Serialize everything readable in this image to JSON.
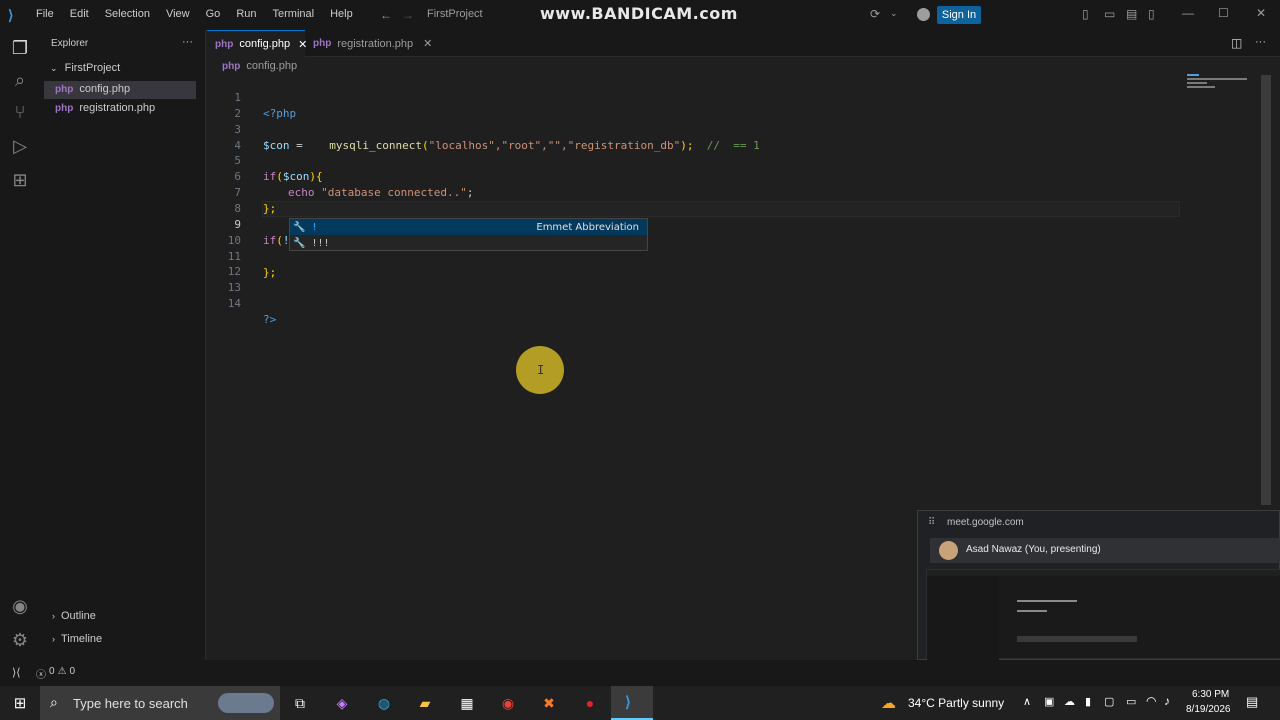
{
  "titlebar": {
    "menus": [
      "File",
      "Edit",
      "Selection",
      "View",
      "Go",
      "Run",
      "Terminal",
      "Help"
    ],
    "search_label": "FirstProject",
    "watermark": "www.BANDICAM.com",
    "signin_label": "Sign In"
  },
  "sidebar": {
    "title": "Explorer",
    "project": "FirstProject",
    "files": [
      "config.php",
      "registration.php"
    ],
    "outline_label": "Outline",
    "timeline_label": "Timeline"
  },
  "tabs": [
    {
      "label": "config.php"
    },
    {
      "label": "registration.php"
    }
  ],
  "breadcrumb": "config.php",
  "code": {
    "line_numbers": [
      "1",
      "2",
      "3",
      "4",
      "5",
      "6",
      "7",
      "8",
      "9",
      "10",
      "11",
      "12",
      "13",
      "14"
    ],
    "l1": "<?php",
    "l3a": "$con",
    "l3b": " = ",
    "l3c": "mysqli_connect",
    "l3d": "(",
    "l3e": "\"localhos\",\"root\",\"\",\"registration_db\"",
    "l3f": ");",
    "l3g": "//  == 1",
    "l5a": "if",
    "l5b": "(",
    "l5c": "$con",
    "l5d": "){",
    "l6a": "echo",
    "l6b": "\"database connected..\"",
    "l6c": ";",
    "l7": "};",
    "l9a": "if",
    "l9b": "(",
    "l9c": "!$con",
    "l9d": "){",
    "l11": "};",
    "l14": "?>"
  },
  "suggest": {
    "item1": "!",
    "item1_detail": "Emmet Abbreviation",
    "item2": "!!!"
  },
  "status": {
    "errors": "0",
    "warnings": "0"
  },
  "meet": {
    "domain": "meet.google.com",
    "presenter": "Asad Nawaz (You, presenting)"
  },
  "taskbar": {
    "search_placeholder": "Type here to search",
    "weather": "34°C  Partly sunny",
    "time": "6:30 PM",
    "date": "8/19/2026"
  }
}
